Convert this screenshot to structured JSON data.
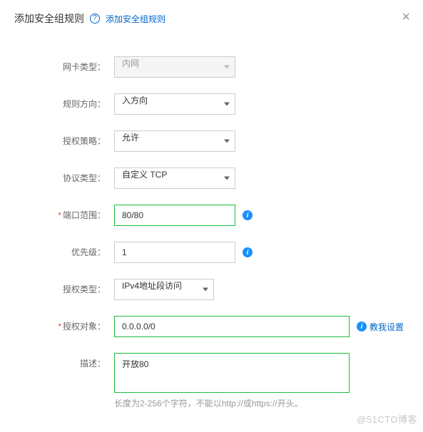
{
  "header": {
    "title": "添加安全组规则",
    "help_link": "添加安全组规则",
    "close": "×"
  },
  "labels": {
    "nic_type": "网卡类型：",
    "direction": "规则方向：",
    "policy": "授权策略：",
    "protocol": "协议类型：",
    "port_range": "端口范围：",
    "priority": "优先级：",
    "auth_type": "授权类型：",
    "auth_object": "授权对象：",
    "description": "描述："
  },
  "values": {
    "nic_type": "内网",
    "direction": "入方向",
    "policy": "允许",
    "protocol": "自定义 TCP",
    "port_range": "80/80",
    "priority": "1",
    "auth_type": "IPv4地址段访问",
    "auth_object": "0.0.0.0/0",
    "description": "开放80"
  },
  "teach_link": "教我设置",
  "desc_hint": "长度为2-256个字符，不能以http://或https://开头。",
  "watermark": "@51CTO博客"
}
